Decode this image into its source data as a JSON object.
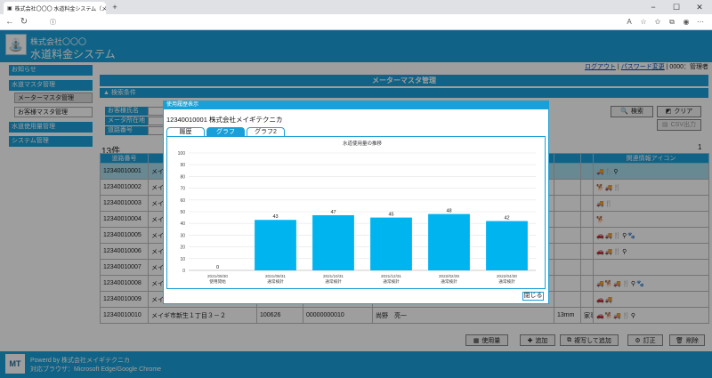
{
  "browser": {
    "tab_title": "株式会社〇〇〇 水道料金システム（メーター",
    "url_text": "",
    "new_tab": "+",
    "window_controls": [
      "−",
      "☐",
      "✕"
    ]
  },
  "header": {
    "company": "株式会社〇〇〇",
    "system": "水道料金システム"
  },
  "userline": {
    "logout": "ログアウト",
    "sep": "|",
    "password": "パスワード変更",
    "user": "| 0000：管理者"
  },
  "sidebar": {
    "items": [
      {
        "label": "お知らせ"
      },
      {
        "label": "水道マスタ管理"
      },
      {
        "label": "メーターマスタ管理"
      },
      {
        "label": "お客様マスタ管理"
      },
      {
        "label": "水道使用量管理"
      },
      {
        "label": "システム管理"
      }
    ]
  },
  "main": {
    "title": "メーターマスタ管理",
    "cond_title": "▲ 検索条件",
    "fields": [
      {
        "label": "お客様氏名"
      },
      {
        "label": "メータ所在地"
      },
      {
        "label": "道路番号"
      }
    ],
    "search_label": "検索",
    "clear_label": "クリア",
    "csv_label": "CSV出力",
    "count": "13件",
    "page": "1"
  },
  "table": {
    "headers": [
      "道路番号",
      "",
      "",
      "",
      "",
      "",
      "",
      "関連情報アイコン"
    ],
    "rows": [
      {
        "id": "12340010001",
        "c2": "メイ",
        "c3": "",
        "c4": "",
        "c5": "",
        "c6": "",
        "c7": "",
        "icons": "🚚🍴⚲"
      },
      {
        "id": "12340010002",
        "c2": "メイ",
        "c3": "",
        "c4": "",
        "c5": "",
        "c6": "",
        "c7": "",
        "icons": "🐕🚚🍴"
      },
      {
        "id": "12340010003",
        "c2": "メイ",
        "c3": "",
        "c4": "",
        "c5": "",
        "c6": "",
        "c7": "",
        "icons": "🚚🍴"
      },
      {
        "id": "12340010004",
        "c2": "メイ",
        "c3": "",
        "c4": "",
        "c5": "",
        "c6": "",
        "c7": "",
        "icons": "🐕"
      },
      {
        "id": "12340010005",
        "c2": "メイ",
        "c3": "",
        "c4": "",
        "c5": "",
        "c6": "",
        "c7": "",
        "icons": "🚗🚚🍴⚲🐾"
      },
      {
        "id": "12340010006",
        "c2": "メイ",
        "c3": "",
        "c4": "",
        "c5": "",
        "c6": "",
        "c7": "",
        "icons": "🚗🚚🍴⚲"
      },
      {
        "id": "12340010007",
        "c2": "メイ",
        "c3": "",
        "c4": "",
        "c5": "",
        "c6": "",
        "c7": "",
        "icons": ""
      },
      {
        "id": "12340010008",
        "c2": "メイ",
        "c3": "",
        "c4": "",
        "c5": "",
        "c6": "",
        "c7": "",
        "icons": "🚚🐕🚚🍴⚲🐾"
      },
      {
        "id": "12340010009",
        "c2": "メイ",
        "c3": "",
        "c4": "",
        "c5": "",
        "c6": "",
        "c7": "",
        "icons": "🚗🚚"
      },
      {
        "id": "12340010010",
        "c2": "メイギ市新生１丁目３－２",
        "c3": "100626",
        "c4": "00000000010",
        "c5": "尚野　亮一",
        "c6": "13mm",
        "c7": "家事用",
        "icons": "🚗🐕🚚🍴⚲"
      }
    ]
  },
  "toolbar": {
    "usage": "使用量",
    "add": "追加",
    "copy_add": "複写して追加",
    "fix": "訂正",
    "delete": "削除"
  },
  "footer": {
    "logo": "MT",
    "powered": "Powerd by 株式会社メイギテクニカ",
    "browser": "対応ブラウザ：Microsoft Edge/Google Chrome"
  },
  "modal": {
    "title": "使用履歴表示",
    "record": "12340010001 株式会社メイギテクニカ",
    "tabs": [
      "履歴",
      "グラフ",
      "グラフ2"
    ],
    "close": "閉じる"
  },
  "colors": {
    "accent": "#1aa0d8",
    "bar": "#00b4f0"
  },
  "chart_data": {
    "type": "bar",
    "title": "水道使用量の推移",
    "categories": [
      "2021/09/30\n使用開始",
      "2021/08/31\n通常検針",
      "2021/10/31\n通常検針",
      "2021/12/31\n通常検針",
      "2022/02/28\n通常検針",
      "2022/04/30\n通常検針"
    ],
    "values": [
      0,
      43,
      47,
      45,
      48,
      42
    ],
    "ylim": [
      0,
      100
    ],
    "yticks": [
      0,
      10,
      20,
      30,
      40,
      50,
      60,
      70,
      80,
      90,
      100
    ],
    "grid": true,
    "xlabel": "",
    "ylabel": ""
  }
}
